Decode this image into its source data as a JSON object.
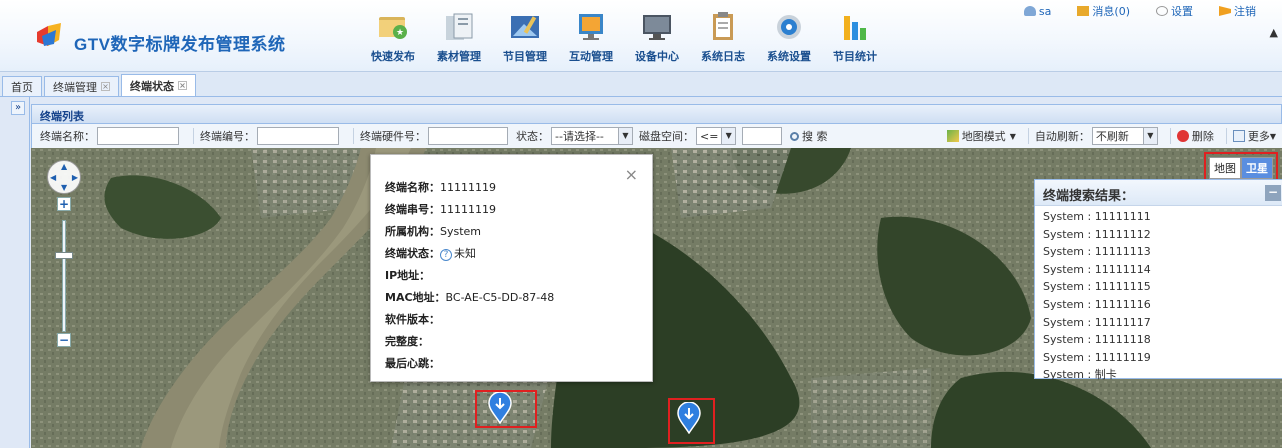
{
  "app": {
    "title": "GTV数字标牌发布管理系统"
  },
  "nav": [
    {
      "label": "快速发布",
      "icon": "quick-publish-icon"
    },
    {
      "label": "素材管理",
      "icon": "material-icon"
    },
    {
      "label": "节目管理",
      "icon": "program-icon"
    },
    {
      "label": "互动管理",
      "icon": "interactive-icon"
    },
    {
      "label": "设备中心",
      "icon": "device-icon"
    },
    {
      "label": "系统日志",
      "icon": "log-icon"
    },
    {
      "label": "系统设置",
      "icon": "settings-icon"
    },
    {
      "label": "节目统计",
      "icon": "stats-icon"
    }
  ],
  "topbar": {
    "user": "sa",
    "messages": "消息(0)",
    "settings": "设置",
    "logout": "注销"
  },
  "tabs": {
    "home": "首页",
    "terminal_manage": "终端管理",
    "terminal_status": "终端状态"
  },
  "panel": {
    "title": "终端列表"
  },
  "toolbar": {
    "name_label": "终端名称：",
    "number_label": "终端编号：",
    "hardware_label": "终端硬件号：",
    "status_label": "状态：",
    "status_value": "--请选择--",
    "disk_label": "磁盘空间：",
    "disk_op": "<=",
    "search": "搜 索",
    "map_mode": "地图模式",
    "auto_refresh_label": "自动刷新：",
    "auto_refresh_value": "不刷新",
    "delete": "删除",
    "more": "更多"
  },
  "popup": {
    "rows": [
      {
        "label": "终端名称：",
        "value": "11111119"
      },
      {
        "label": "终端串号：",
        "value": "11111119"
      },
      {
        "label": "所属机构：",
        "value": "System"
      },
      {
        "label": "终端状态：",
        "value": "未知"
      },
      {
        "label": "IP地址：",
        "value": ""
      },
      {
        "label": "MAC地址：",
        "value": "BC-AE-C5-DD-87-48"
      },
      {
        "label": "软件版本：",
        "value": ""
      },
      {
        "label": "完整度：",
        "value": ""
      },
      {
        "label": "最后心跳：",
        "value": ""
      }
    ],
    "close": "×"
  },
  "maptype": {
    "map": "地图",
    "satellite": "卫星"
  },
  "results": {
    "title": "终端搜索结果：",
    "items": [
      "System : 11111111",
      "System : 11111112",
      "System : 11111113",
      "System : 11111114",
      "System : 11111115",
      "System : 11111116",
      "System : 11111117",
      "System : 11111118",
      "System : 11111119",
      "System : 制卡"
    ]
  },
  "colors": {
    "brand_blue": "#1f66b8",
    "highlight_red": "#e02020",
    "marker_blue": "#2f7fe0"
  }
}
